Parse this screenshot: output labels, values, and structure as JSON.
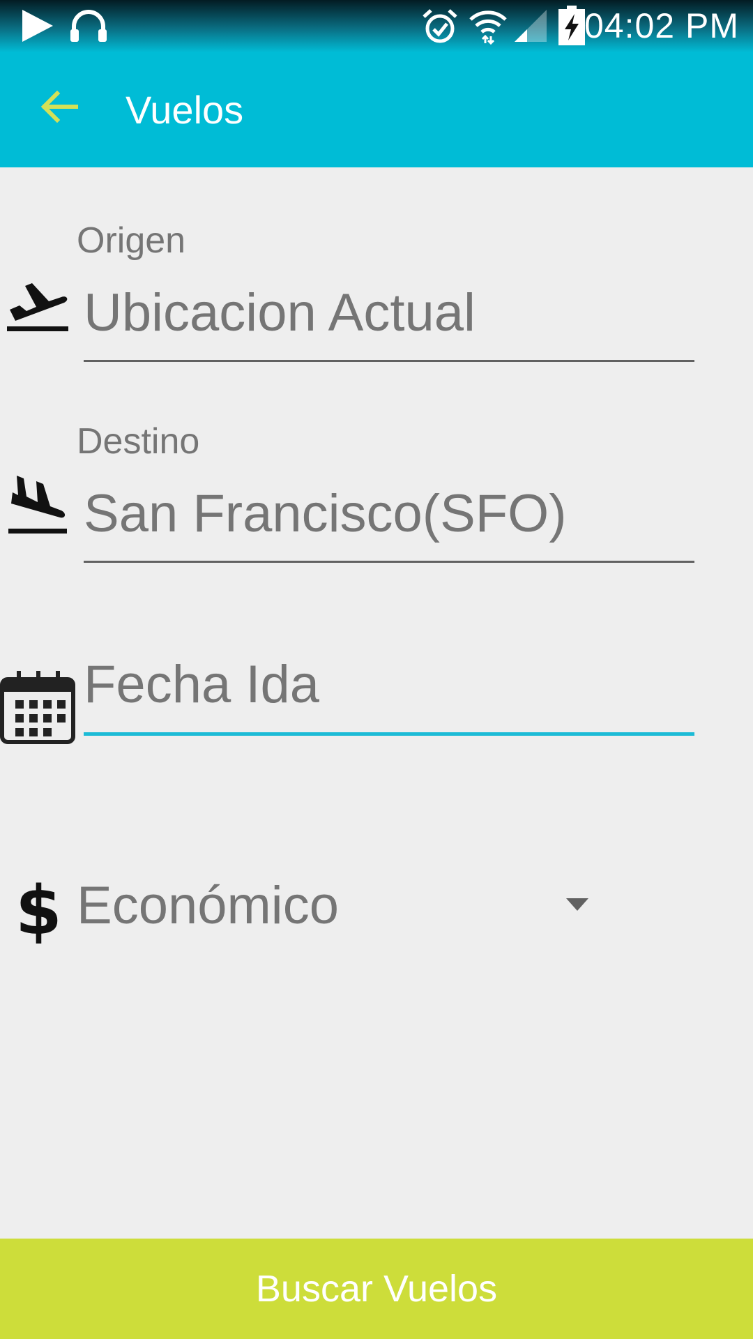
{
  "status_bar": {
    "time": "04:02 PM",
    "icons": [
      "play-icon",
      "headphones-icon",
      "alarm-icon",
      "wifi-icon",
      "signal-icon",
      "battery-charging-icon"
    ]
  },
  "app_bar": {
    "title": "Vuelos",
    "back_icon": "arrow-back-icon",
    "back_color": "#d4e157",
    "background": "#00bcd6"
  },
  "form": {
    "origin": {
      "label": "Origen",
      "value": "Ubicacion Actual",
      "icon": "flight-takeoff-icon"
    },
    "destination": {
      "label": "Destino",
      "value": "San Francisco(SFO)",
      "icon": "flight-land-icon"
    },
    "departure_date": {
      "placeholder": "Fecha Ida",
      "icon": "calendar-icon"
    },
    "class": {
      "selected": "Económico",
      "icon": "dollar-icon",
      "symbol": "$"
    }
  },
  "search_button": {
    "label": "Buscar Vuelos",
    "color": "#cddd3a"
  }
}
